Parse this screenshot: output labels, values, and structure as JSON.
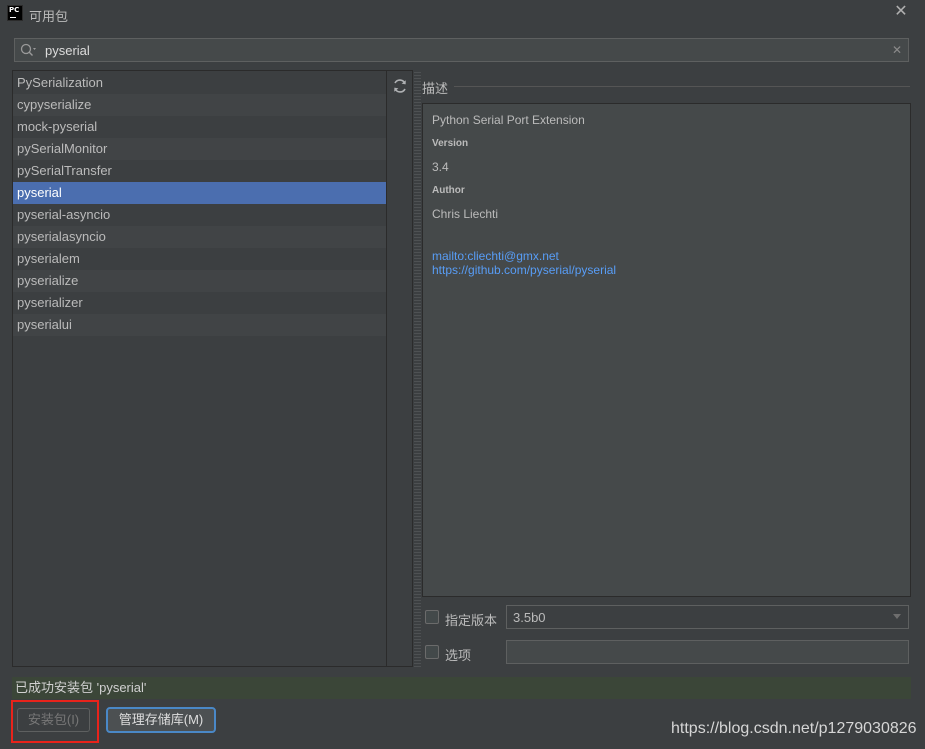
{
  "window": {
    "title": "可用包",
    "app_icon_text": "PC"
  },
  "search": {
    "value": "pyserial"
  },
  "packages": [
    "PySerialization",
    "cypyserialize",
    "mock-pyserial",
    "pySerialMonitor",
    "pySerialTransfer",
    "pyserial",
    "pyserial-asyncio",
    "pyserialasyncio",
    "pyserialem",
    "pyserialize",
    "pyserializer",
    "pyserialui"
  ],
  "selected_package": "pyserial",
  "description": {
    "section_title": "描述",
    "summary": "Python Serial Port Extension",
    "version_label": "Version",
    "version_value": "3.4",
    "author_label": "Author",
    "author_value": "Chris Liechti",
    "email_link": "mailto:cliechti@gmx.net",
    "home_link": "https://github.com/pyserial/pyserial"
  },
  "options": {
    "specify_version_label": "指定版本",
    "specify_version_checked": false,
    "version_value": "3.5b0",
    "options_label": "选项",
    "options_checked": false,
    "options_value": ""
  },
  "status": {
    "message": "已成功安装包 'pyserial'"
  },
  "buttons": {
    "install": "安装包(I)",
    "manage": "管理存储库(M)"
  },
  "watermark": "https://blog.csdn.net/p1279030826",
  "colors": {
    "background": "#3c3f41",
    "selection": "#4b6eaf",
    "link": "#589df6",
    "status_bg": "#3b4638",
    "highlight": "#e8231b"
  }
}
